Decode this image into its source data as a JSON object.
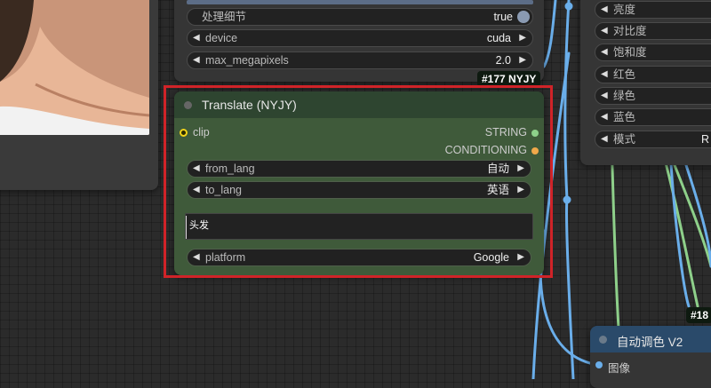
{
  "top_node": {
    "widgets": [
      {
        "label": "处理细节",
        "value": "true"
      },
      {
        "label": "device",
        "value": "cuda"
      },
      {
        "label": "max_megapixels",
        "value": "2.0"
      }
    ]
  },
  "translate_node": {
    "badge": "#177 NYJY",
    "title": "Translate (NYJY)",
    "input": "clip",
    "outputs": [
      "STRING",
      "CONDITIONING"
    ],
    "from_lang": {
      "label": "from_lang",
      "value": "自动"
    },
    "to_lang": {
      "label": "to_lang",
      "value": "英语"
    },
    "text": "头发",
    "platform": {
      "label": "platform",
      "value": "Google"
    }
  },
  "adjust_node": {
    "widgets": [
      "亮度",
      "对比度",
      "饱和度",
      "红色",
      "绿色",
      "蓝色",
      "模式"
    ],
    "mode_value": "R"
  },
  "color_node": {
    "badge": "#18",
    "title": "自动调色 V2",
    "input": "图像"
  },
  "colors": {
    "wire_blue": "#6aaeea",
    "wire_green": "#8ed08a",
    "highlight_red": "#d02328",
    "translate_body": "#3f5a3a",
    "translate_header": "#2e4530"
  }
}
